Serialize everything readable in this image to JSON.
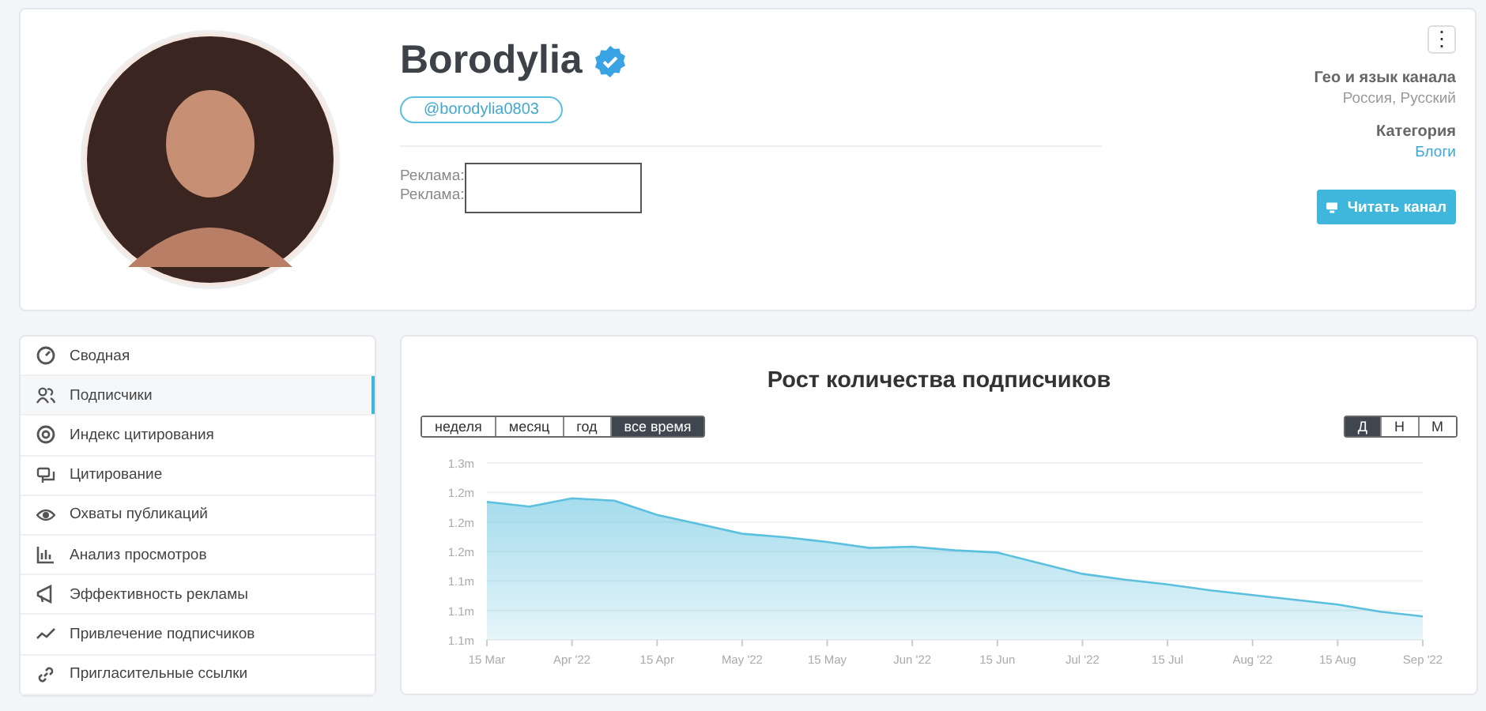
{
  "channel": {
    "name": "Borodylia",
    "verified": true,
    "username": "@borodylia0803",
    "ads": [
      "Реклама:",
      "Реклама:"
    ],
    "geo_label": "Гео и язык канала",
    "geo_value": "Россия, Русский",
    "category_label": "Категория",
    "category_value": "Блоги",
    "read_button": "Читать канал",
    "more_button": "⋮"
  },
  "sidebar": {
    "items": [
      {
        "label": "Сводная",
        "selected": false
      },
      {
        "label": "Подписчики",
        "selected": true
      },
      {
        "label": "Индекс цитирования",
        "selected": false
      },
      {
        "label": "Цитирование",
        "selected": false
      },
      {
        "label": "Охваты публикаций",
        "selected": false
      },
      {
        "label": "Анализ просмотров",
        "selected": false
      },
      {
        "label": "Эффективность рекламы",
        "selected": false
      },
      {
        "label": "Привлечение подписчиков",
        "selected": false
      },
      {
        "label": "Пригласительные ссылки",
        "selected": false
      }
    ]
  },
  "chart_card": {
    "title": "Рост количества подписчиков",
    "periods": [
      {
        "label": "неделя",
        "selected": false
      },
      {
        "label": "месяц",
        "selected": false
      },
      {
        "label": "год",
        "selected": false
      },
      {
        "label": "все время",
        "selected": true
      }
    ],
    "intervals": [
      {
        "label": "Д",
        "selected": true
      },
      {
        "label": "Н",
        "selected": false
      },
      {
        "label": "М",
        "selected": false
      }
    ],
    "chart_data": {
      "type": "area",
      "categories": [
        "15 Mar",
        null,
        "Apr '22",
        null,
        "15 Apr",
        null,
        "May '22",
        null,
        "15 May",
        null,
        "Jun '22",
        null,
        "15 Jun",
        null,
        "Jul '22",
        null,
        "15 Jul",
        null,
        "Aug '22",
        null,
        "15 Aug",
        null,
        "Sep '22"
      ],
      "series": [
        {
          "color": "#5bc0de",
          "values": [
            1.217,
            1.213,
            1.22,
            1.218,
            1.206,
            1.198,
            1.19,
            1.187,
            1.183,
            1.178,
            1.179,
            1.176,
            1.174,
            1.165,
            1.156,
            1.151,
            1.147,
            1.142,
            1.138,
            1.134,
            1.13,
            1.124,
            1.12
          ]
        }
      ],
      "ylim": [
        1.1,
        1.25
      ],
      "grid": true,
      "yticks": [
        {
          "value": 1.25,
          "label": "1.3m"
        },
        {
          "value": 1.225,
          "label": "1.2m"
        },
        {
          "value": 1.2,
          "label": "1.2m"
        },
        {
          "value": 1.175,
          "label": "1.2m"
        },
        {
          "value": 1.15,
          "label": "1.1m"
        },
        {
          "value": 1.125,
          "label": "1.1m"
        },
        {
          "value": 1.1,
          "label": "1.1m"
        }
      ]
    }
  }
}
